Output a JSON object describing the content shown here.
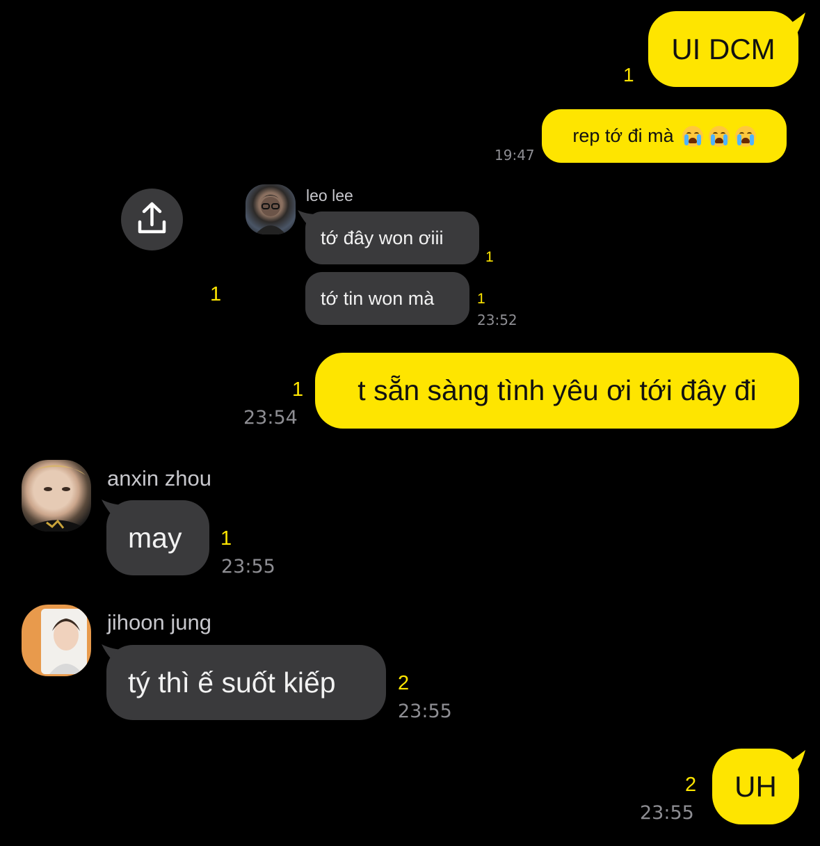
{
  "colors": {
    "my_bubble": "#FEE500",
    "other_bubble": "#3a3a3c",
    "background": "#000000",
    "unread": "#FEE500",
    "timestamp": "#8e8e93"
  },
  "messages": [
    {
      "text": "UI DCM",
      "unread": "1"
    },
    {
      "text": "rep tớ đi mà",
      "emoji": "loudly-crying-face",
      "emoji_count": 3,
      "time": "19:47"
    },
    {
      "sender": "leo lee",
      "text": "tớ đây won ơiii",
      "unread": "1"
    },
    {
      "text": "tớ tin won mà",
      "unread": "1",
      "time": "23:52"
    },
    {
      "text": "t sẵn sàng tình yêu ơi tới đây đi",
      "unread": "1",
      "time": "23:54"
    },
    {
      "sender": "anxin zhou",
      "text": "may",
      "unread": "1",
      "time": "23:55"
    },
    {
      "sender": "jihoon jung",
      "text": "tý thì ế suốt kiếp",
      "unread": "2",
      "time": "23:55"
    },
    {
      "text": "UH",
      "unread": "2",
      "time": "23:55"
    }
  ],
  "floating": {
    "share_icon": "share-upload-icon",
    "stray_unread": "1"
  }
}
